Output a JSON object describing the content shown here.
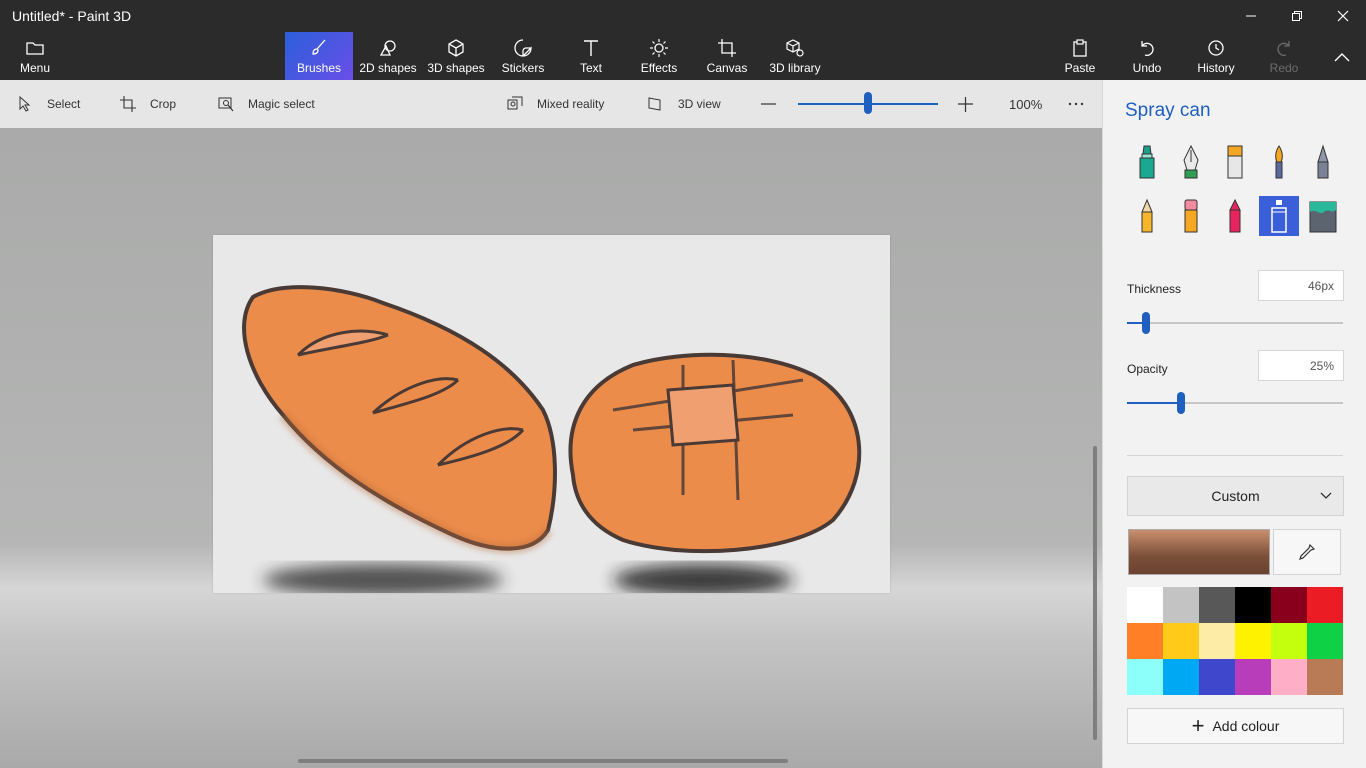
{
  "window": {
    "title": "Untitled* - Paint 3D"
  },
  "ribbon": {
    "menu": "Menu",
    "tools": [
      "Brushes",
      "2D shapes",
      "3D shapes",
      "Stickers",
      "Text",
      "Effects",
      "Canvas",
      "3D library"
    ],
    "active_tool": "Brushes",
    "right": [
      "Paste",
      "Undo",
      "History",
      "Redo"
    ],
    "disabled": [
      "Redo"
    ]
  },
  "toolbar": {
    "select": "Select",
    "crop": "Crop",
    "magic_select": "Magic select",
    "mixed_reality": "Mixed reality",
    "view_3d": "3D view",
    "zoom_level": "100%",
    "zoom_fraction": 0.5
  },
  "panel": {
    "title": "Spray can",
    "brushes": [
      {
        "name": "marker",
        "icon": "marker-icon"
      },
      {
        "name": "calligraphy-pen",
        "icon": "calligraphy-pen-icon"
      },
      {
        "name": "oil-brush",
        "icon": "oil-brush-icon"
      },
      {
        "name": "watercolor",
        "icon": "watercolor-icon"
      },
      {
        "name": "pixel-pen",
        "icon": "pixel-pen-icon"
      },
      {
        "name": "pencil",
        "icon": "pencil-icon"
      },
      {
        "name": "eraser",
        "icon": "eraser-icon"
      },
      {
        "name": "crayon",
        "icon": "crayon-icon"
      },
      {
        "name": "spray-can",
        "icon": "spray-can-icon",
        "selected": true
      },
      {
        "name": "fill",
        "icon": "fill-bucket-icon"
      }
    ],
    "thickness": {
      "label": "Thickness",
      "value": "46px",
      "fraction": 0.09
    },
    "opacity": {
      "label": "Opacity",
      "value": "25%",
      "fraction": 0.25
    },
    "colour_mode": "Custom",
    "current_colour": "#9a6a50",
    "palette": [
      "#ffffff",
      "#c3c3c3",
      "#585858",
      "#000000",
      "#88001b",
      "#ec1c24",
      "#ff7f27",
      "#ffca18",
      "#fdeca6",
      "#fff200",
      "#c4ff0e",
      "#0ed145",
      "#8cfffb",
      "#00a8f3",
      "#3f48cc",
      "#b83dba",
      "#ffaec8",
      "#b97a56"
    ],
    "add_colour": "Add colour"
  },
  "colors": {
    "accent": "#1f5fbf",
    "bread": "#ec8c4b",
    "outline": "#4a3a36"
  }
}
